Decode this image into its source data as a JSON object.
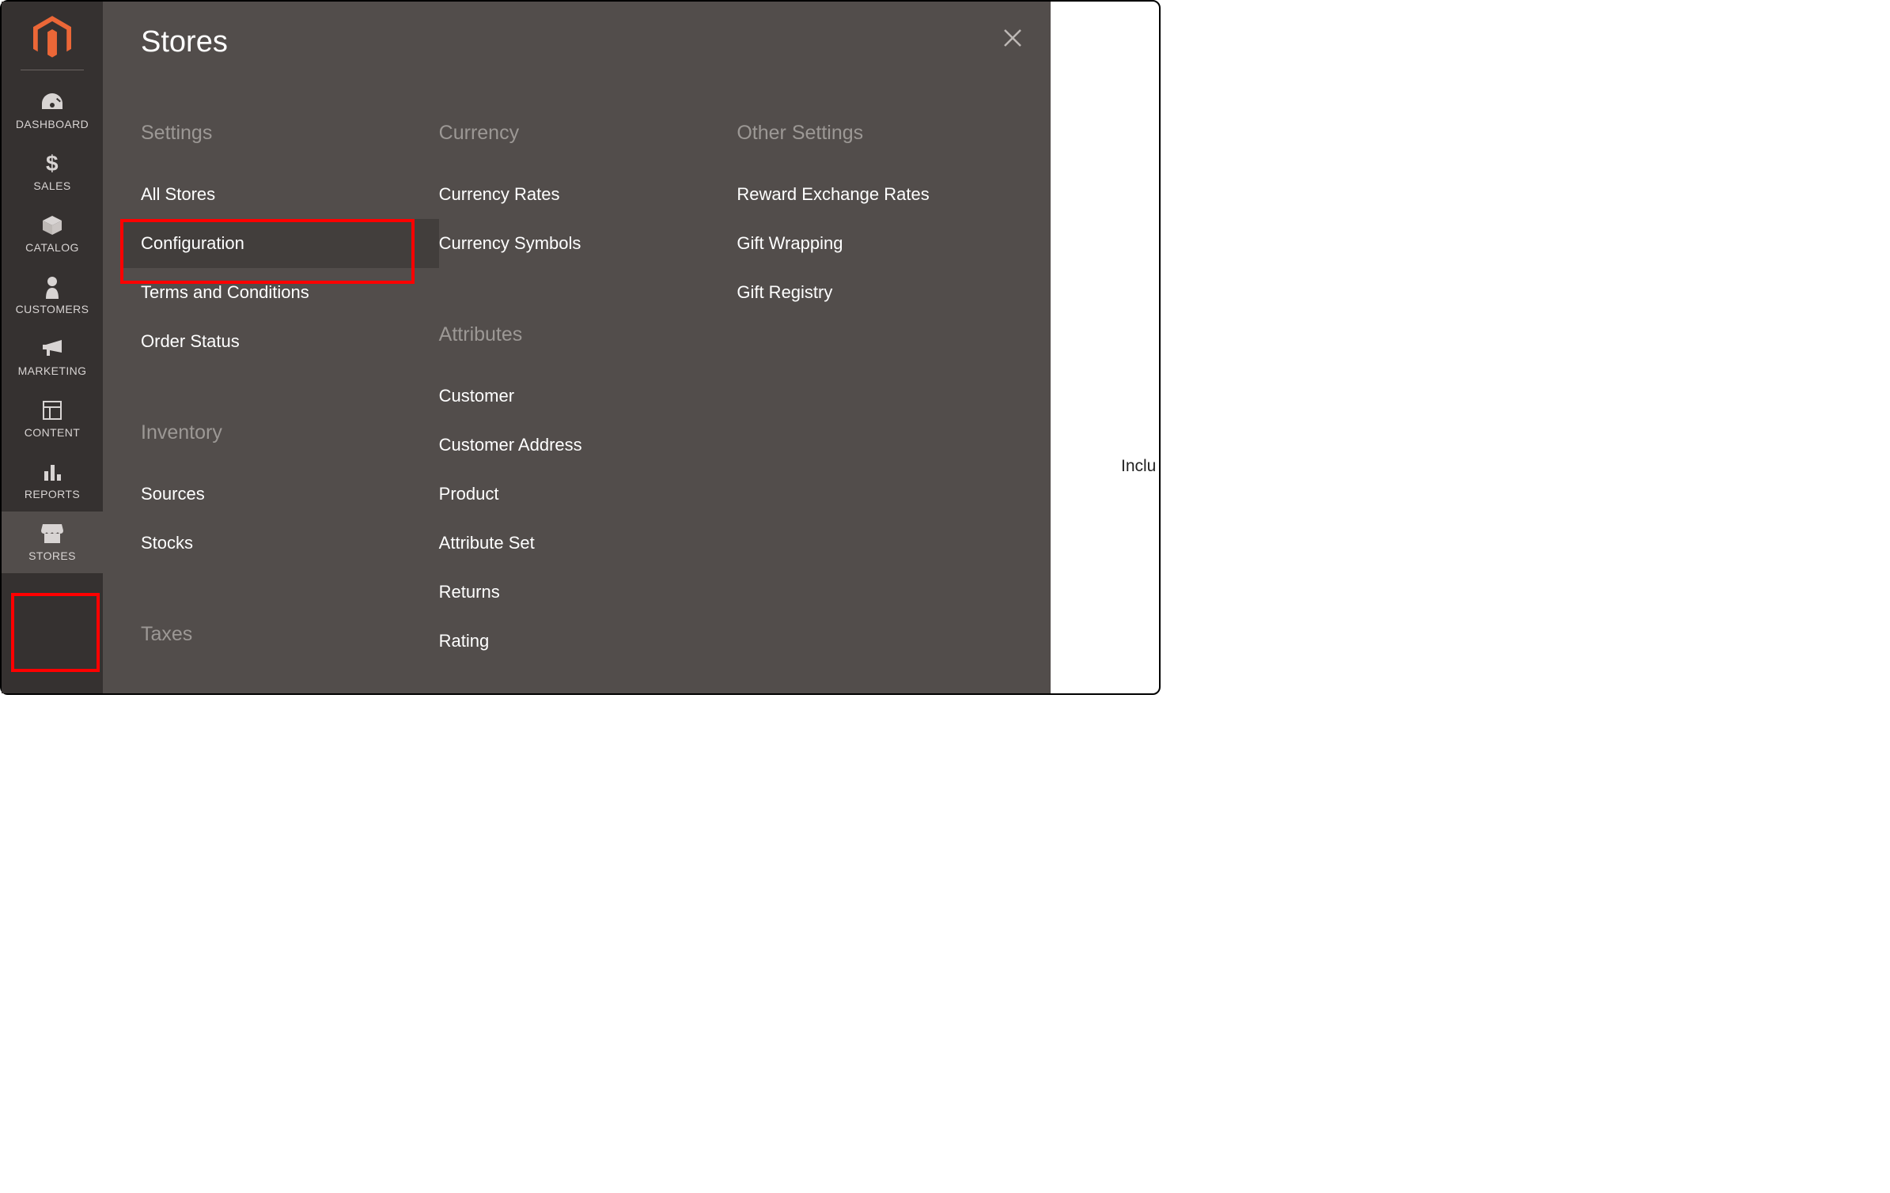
{
  "sidebar": {
    "items": [
      {
        "label": "DASHBOARD"
      },
      {
        "label": "SALES"
      },
      {
        "label": "CATALOG"
      },
      {
        "label": "CUSTOMERS"
      },
      {
        "label": "MARKETING"
      },
      {
        "label": "CONTENT"
      },
      {
        "label": "REPORTS"
      },
      {
        "label": "STORES"
      }
    ]
  },
  "flyout": {
    "title": "Stores",
    "columns": [
      {
        "groups": [
          {
            "title": "Settings",
            "links": [
              "All Stores",
              "Configuration",
              "Terms and Conditions",
              "Order Status"
            ]
          },
          {
            "title": "Inventory",
            "links": [
              "Sources",
              "Stocks"
            ]
          },
          {
            "title": "Taxes",
            "links": []
          }
        ]
      },
      {
        "groups": [
          {
            "title": "Currency",
            "links": [
              "Currency Rates",
              "Currency Symbols"
            ]
          },
          {
            "title": "Attributes",
            "links": [
              "Customer",
              "Customer Address",
              "Product",
              "Attribute Set",
              "Returns",
              "Rating"
            ]
          }
        ]
      },
      {
        "groups": [
          {
            "title": "Other Settings",
            "links": [
              "Reward Exchange Rates",
              "Gift Wrapping",
              "Gift Registry"
            ]
          }
        ]
      }
    ]
  },
  "bg": {
    "partial": "Inclu"
  }
}
